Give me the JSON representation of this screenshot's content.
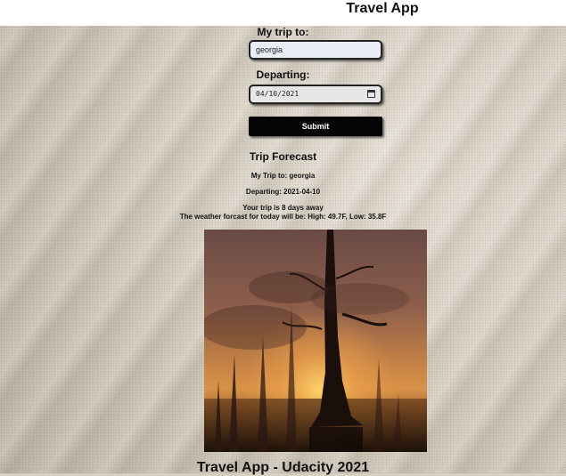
{
  "app": {
    "title": "Travel App"
  },
  "form": {
    "destination_label": "My trip to:",
    "destination_value": "georgia",
    "departing_label": "Departing:",
    "departing_value": "04/10/2021",
    "submit_label": "Submit"
  },
  "forecast": {
    "title": "Trip Forecast",
    "my_trip": "My Trip to: georgia",
    "departing": "Departing: 2021-04-10",
    "days_away": "Your trip is 8 days away",
    "weather": "The weather forcast for today will be: High: 49.7F, Low: 35.8F"
  },
  "footer": {
    "text": "Travel App - Udacity 2021"
  },
  "icons": {
    "calendar": "calendar-icon"
  },
  "colors": {
    "topbar": "#ffffff",
    "input_bg": "#e9eef9",
    "button_bg": "#050505",
    "button_text": "#ffffff"
  }
}
